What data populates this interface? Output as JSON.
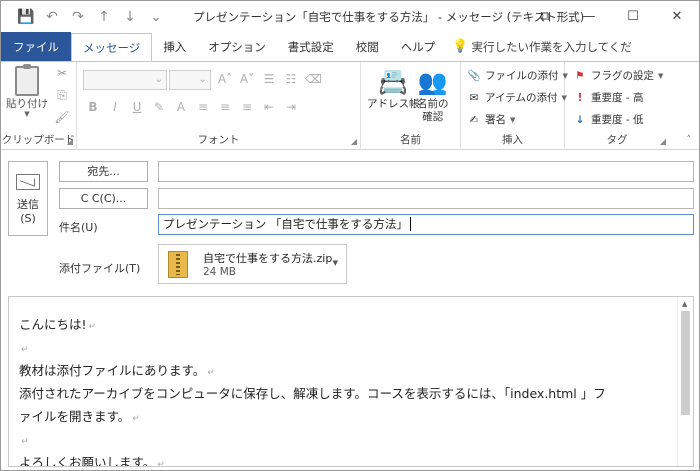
{
  "window": {
    "title": "プレゼンテーション「自宅で仕事をする方法」 - メッセージ (テキスト形式)"
  },
  "quick_access": [
    {
      "name": "save-icon",
      "glyph": "💾"
    },
    {
      "name": "undo-icon",
      "glyph": "↶"
    },
    {
      "name": "redo-icon",
      "glyph": "↷"
    },
    {
      "name": "up-arrow-icon",
      "glyph": "↑"
    },
    {
      "name": "down-arrow-icon",
      "glyph": "↓"
    },
    {
      "name": "customize-icon",
      "glyph": "⌄"
    }
  ],
  "window_buttons": {
    "restore": "⧉",
    "minimize": "—",
    "maximize": "☐",
    "close": "✕"
  },
  "tabs": {
    "file": "ファイル",
    "message": "メッセージ",
    "insert": "挿入",
    "options": "オプション",
    "format": "書式設定",
    "review": "校閲",
    "help": "ヘルプ",
    "tell_me": "実行したい作業を入力してくだ"
  },
  "ribbon": {
    "clipboard": {
      "paste": "貼り付け",
      "label": "クリップボード"
    },
    "font": {
      "label": "フォント"
    },
    "names": {
      "address_book": "アドレス帳",
      "check_names_1": "名前の",
      "check_names_2": "確認",
      "label": "名前"
    },
    "insert": {
      "attach_file": "ファイルの添付",
      "attach_item": "アイテムの添付",
      "signature": "署名",
      "label": "挿入"
    },
    "tags": {
      "follow_up": "フラグの設定",
      "high_importance": "重要度 - 高",
      "low_importance": "重要度 - 低",
      "label": "タグ"
    }
  },
  "compose": {
    "send": "送信",
    "send_key": "(S)",
    "to_button": "宛先...",
    "cc_button": "C C(C)...",
    "to_value": "",
    "cc_value": "",
    "subject_label": "件名(U)",
    "subject_value": "プレゼンテーション 「自宅で仕事をする方法」",
    "attach_label": "添付ファイル(T)",
    "attachment": {
      "name": "自宅で仕事をする方法.zip",
      "size": "24 MB"
    }
  },
  "body": {
    "lines": [
      "こんにちは!",
      "",
      "教材は添付ファイルにあります。",
      "添付されたアーカイブをコンピュータに保存し、解凍します。コースを表示するには、「index.html 」フ",
      "ァイルを開きます。",
      "",
      "よろしくお願いします。"
    ]
  }
}
